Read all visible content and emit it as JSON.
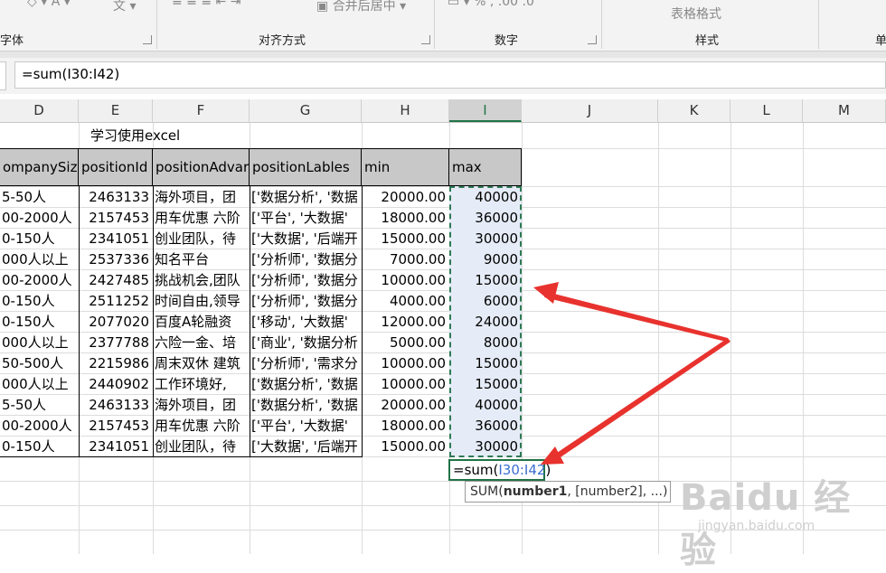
{
  "ribbon": {
    "groups": [
      {
        "label": "字体"
      },
      {
        "label": "对齐方式",
        "merge_center": "合并后居中"
      },
      {
        "label": "数字"
      },
      {
        "label": "样式",
        "table_format": "表格格式"
      },
      {
        "label": "单"
      }
    ]
  },
  "formula_bar": {
    "value": "=sum(I30:I42)"
  },
  "columns": [
    "D",
    "E",
    "F",
    "G",
    "H",
    "I",
    "J",
    "K",
    "L",
    "M"
  ],
  "sheet": {
    "title": "学习使用excel",
    "headers": [
      "ompanySize",
      "positionId",
      "positionAdvar",
      "positionLables",
      "min",
      "max"
    ],
    "rows": [
      [
        "5-50人",
        "2463133",
        "海外项目，团",
        "['数据分析', '数据",
        "20000.00",
        "40000"
      ],
      [
        "00-2000人",
        "2157453",
        "用车优惠 六阶",
        "['平台', '大数据'",
        "18000.00",
        "36000"
      ],
      [
        "0-150人",
        "2341051",
        "创业团队，待",
        "['大数据', '后端开",
        "15000.00",
        "30000"
      ],
      [
        "000人以上",
        "2537336",
        "知名平台",
        "['分析师', '数据分",
        "7000.00",
        "9000"
      ],
      [
        "00-2000人",
        "2427485",
        "挑战机会,团队",
        "['分析师', '数据分",
        "10000.00",
        "15000"
      ],
      [
        "0-150人",
        "2511252",
        "时间自由,领导",
        "['分析师', '数据分",
        "4000.00",
        "6000"
      ],
      [
        "0-150人",
        "2077020",
        "百度A轮融资",
        "['移动', '大数据'",
        "12000.00",
        "24000"
      ],
      [
        "000人以上",
        "2377788",
        "六险一金、培",
        "['商业', '数据分析",
        "5000.00",
        "8000"
      ],
      [
        "50-500人",
        "2215986",
        "周末双休 建筑",
        "['分析师', '需求分",
        "10000.00",
        "15000"
      ],
      [
        "000人以上",
        "2440902",
        "工作环境好,",
        "['数据分析', '数据",
        "10000.00",
        "15000"
      ],
      [
        "5-50人",
        "2463133",
        "海外项目，团",
        "['数据分析', '数据",
        "20000.00",
        "40000"
      ],
      [
        "00-2000人",
        "2157453",
        "用车优惠 六阶",
        "['平台', '大数据'",
        "18000.00",
        "36000"
      ],
      [
        "0-150人",
        "2341051",
        "创业团队，待",
        "['大数据', '后端开",
        "15000.00",
        "30000"
      ]
    ],
    "active_cell": {
      "prefix": "=sum(",
      "ref": "I30:I42",
      "suffix": ")"
    }
  },
  "tooltip": {
    "func": "SUM(",
    "arg1": "number1",
    "rest": ", [number2], ...)"
  },
  "watermark": {
    "brand": "Baidu 经验",
    "url": "jingyan.baidu.com"
  },
  "colors": {
    "accent": "#217346",
    "selection": "#e6ecf7",
    "arrow": "#e8322e",
    "ref": "#3b6fd0"
  }
}
